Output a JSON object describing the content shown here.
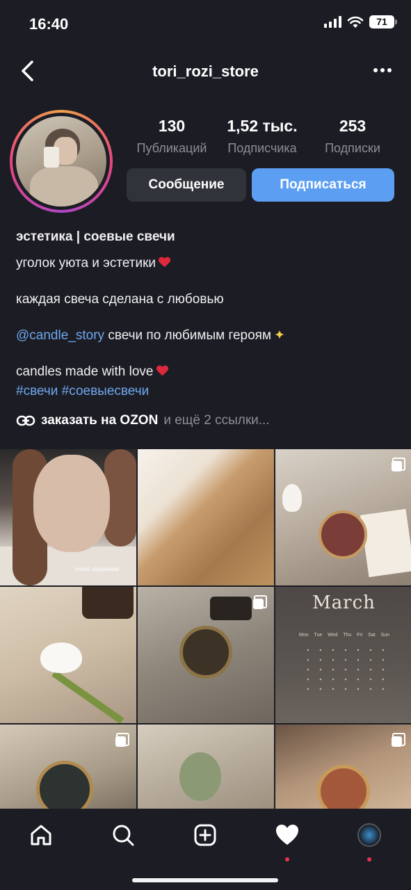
{
  "status_bar": {
    "time": "16:40",
    "battery": "71"
  },
  "header": {
    "title": "tori_rozi_store"
  },
  "profile": {
    "stats": [
      {
        "value": "130",
        "label": "Публикаций"
      },
      {
        "value": "1,52 тыс.",
        "label": "Подписчика"
      },
      {
        "value": "253",
        "label": "Подписки"
      }
    ],
    "message_button": "Сообщение",
    "follow_button": "Подписаться"
  },
  "bio": {
    "name": "эстетика | соевые свечи",
    "line1": "уголок уюта и эстетики",
    "line2": "каждая свеча сделана с любовью",
    "mention": "@candle_story",
    "line3_rest": "свечи по любимым героям",
    "line4": "candles made with love",
    "hashtags": "#свечи #соевыесвечи",
    "link_text": "заказать на OZON",
    "link_more": "и ещё 2 ссылки..."
  },
  "grid": {
    "post1_caption": "mood: ауурнаааа",
    "post6_month": "March",
    "post6_days": [
      "Mon",
      "Tue",
      "Wed",
      "Thu",
      "Fri",
      "Sat",
      "Sun"
    ]
  },
  "colors": {
    "background": "#1c1d24",
    "accent_blue": "#5c9ff2",
    "link_blue": "#6fa7ee",
    "notification_dot": "#e6344a"
  },
  "icons": [
    "back-chevron-icon",
    "more-dots-icon",
    "link-icon",
    "multi-post-icon",
    "home-icon",
    "search-icon",
    "create-icon",
    "heart-icon"
  ]
}
